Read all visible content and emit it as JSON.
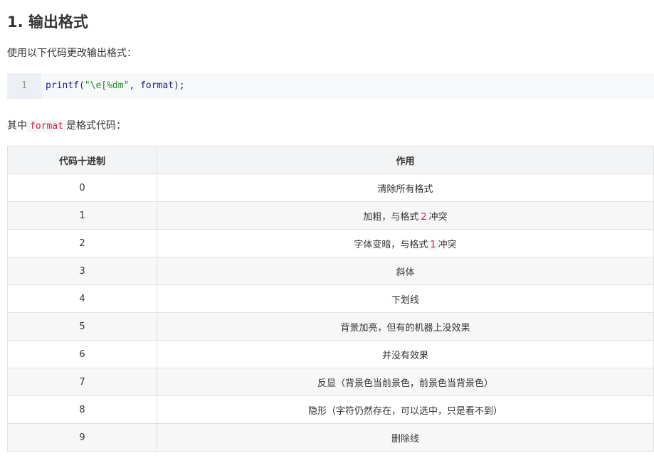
{
  "heading": "1. 输出格式",
  "intro": "使用以下代码更改输出格式：",
  "code": {
    "line_number": "1",
    "fn": "printf",
    "open": "(",
    "string": "\"\\e[%dm\"",
    "comma": ",",
    "var": "format",
    "close": ");"
  },
  "subtitle": {
    "prefix": "其中",
    "code": "format",
    "suffix": "是格式代码："
  },
  "table": {
    "headers": [
      "代码十进制",
      "作用"
    ],
    "rows": [
      {
        "code": "0",
        "text": "清除所有格式"
      },
      {
        "code": "1",
        "text_before": "加粗，与格式",
        "highlight": "2",
        "text_after": "冲突"
      },
      {
        "code": "2",
        "text_before": "字体变暗，与格式",
        "highlight": "1",
        "text_after": "冲突"
      },
      {
        "code": "3",
        "text": "斜体"
      },
      {
        "code": "4",
        "text": "下划线"
      },
      {
        "code": "5",
        "text": "背景加亮，但有的机器上没效果"
      },
      {
        "code": "6",
        "text": "并没有效果"
      },
      {
        "code": "7",
        "text": "反显（背景色当前景色，前景色当背景色）"
      },
      {
        "code": "8",
        "text": "隐形（字符仍然存在，可以选中，只是看不到）"
      },
      {
        "code": "9",
        "text": "删除线"
      }
    ]
  }
}
